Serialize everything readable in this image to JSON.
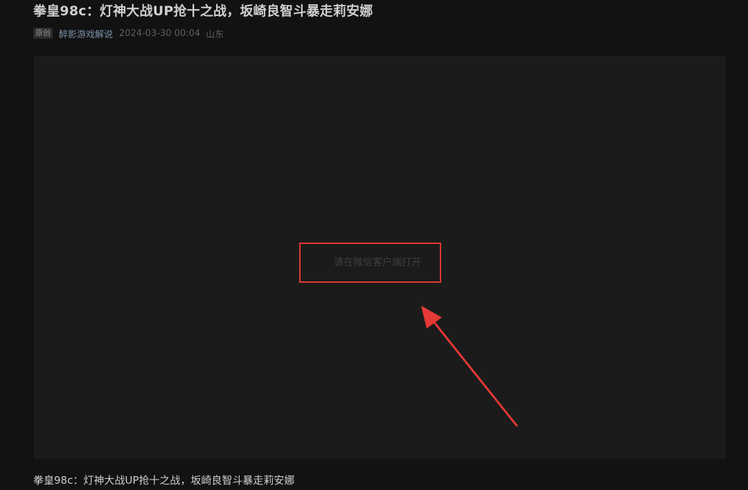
{
  "article": {
    "title": "拳皇98c：灯神大战UP抢十之战，坂崎良智斗暴走莉安娜",
    "badge": "原创",
    "author": "醉影游戏解说",
    "date": "2024-03-30 00:04",
    "location": "山东",
    "caption": "拳皇98c：灯神大战UP抢十之战，坂崎良智斗暴走莉安娜"
  },
  "player": {
    "message": "请在微信客户端打开"
  },
  "annotation": {
    "color": "#e53935",
    "arrow_icon": "arrow-icon"
  }
}
